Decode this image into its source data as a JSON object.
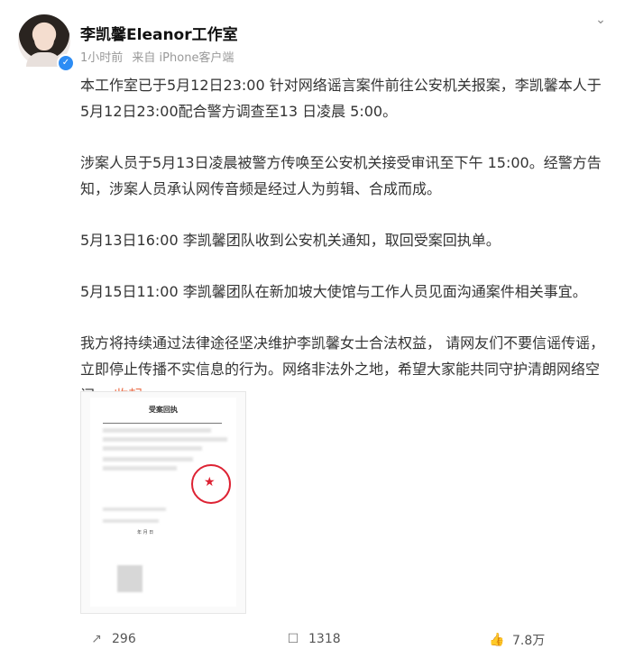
{
  "post": {
    "author": "李凯馨Eleanor工作室",
    "time": "1小时前",
    "source": "来自 iPhone客户端",
    "paragraphs": [
      "本工作室已于5月12日23:00 针对网络谣言案件前往公安机关报案，李凯馨本人于5月12日23:00配合警方调查至13 日凌晨 5:00。",
      "涉案人员于5月13日凌晨被警方传唤至公安机关接受审讯至下午 15:00。经警方告知，涉案人员承认网传音频是经过人为剪辑、合成而成。",
      "5月13日16:00 李凯馨团队收到公安机关通知，取回受案回执单。",
      "5月15日11:00 李凯馨团队在新加坡大使馆与工作人员见面沟通案件相关事宜。",
      "我方将持续通过法律途径坚决维护李凯馨女士合法权益， 请网友们不要信谣传谣，立即停止传播不实信息的行为。网络非法外之地，希望大家能共同守护清朗网络空间。"
    ],
    "collapse_label": "收起"
  },
  "document": {
    "title": "受案回执",
    "lines": [
      "年 月 日"
    ]
  },
  "footer": {
    "repost_count": "296",
    "comment_count": "1318",
    "like_count": "7.8万"
  },
  "icons": {
    "more": "chevron-down-icon",
    "verified": "verified-badge-icon",
    "repost": "repost-icon",
    "comment": "comment-icon",
    "like": "thumb-up-icon"
  },
  "colors": {
    "accent": "#eb7350",
    "verified": "#2c8cf4"
  }
}
